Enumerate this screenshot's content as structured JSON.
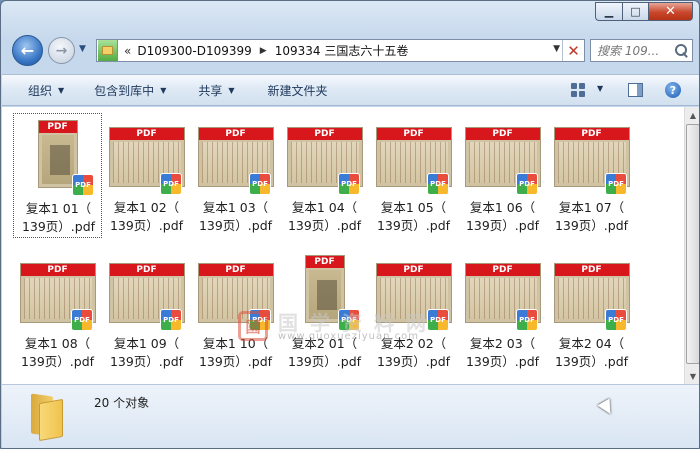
{
  "breadcrumb": {
    "overflow": "«",
    "items": [
      "D109300-D109399",
      "109334 三国志六十五卷"
    ]
  },
  "search": {
    "placeholder": "搜索 109..."
  },
  "toolbar": {
    "organize": "组织",
    "include_library": "包含到库中",
    "share": "共享",
    "new_folder": "新建文件夹"
  },
  "badge_label": "PDF",
  "files": [
    {
      "line1": "复本1 01（",
      "line2": "139页）.pdf",
      "selected": true
    },
    {
      "line1": "复本1 02（",
      "line2": "139页）.pdf"
    },
    {
      "line1": "复本1 03（",
      "line2": "139页）.pdf"
    },
    {
      "line1": "复本1 04（",
      "line2": "139页）.pdf"
    },
    {
      "line1": "复本1 05（",
      "line2": "139页）.pdf"
    },
    {
      "line1": "复本1 06（",
      "line2": "139页）.pdf"
    },
    {
      "line1": "复本1 07（",
      "line2": "139页）.pdf"
    },
    {
      "line1": "复本1 08（",
      "line2": "139页）.pdf"
    },
    {
      "line1": "复本1 09（",
      "line2": "139页）.pdf"
    },
    {
      "line1": "复本1 10（",
      "line2": "139页）.pdf"
    },
    {
      "line1": "复本2 01（",
      "line2": "139页）.pdf"
    },
    {
      "line1": "复本2 02（",
      "line2": "139页）.pdf"
    },
    {
      "line1": "复本2 03（",
      "line2": "139页）.pdf"
    },
    {
      "line1": "复本2 04（",
      "line2": "139页）.pdf"
    }
  ],
  "watermark": {
    "title": "国学资料网",
    "url": "www.guoxueziyuan.com"
  },
  "status": {
    "count_text": "20 个对象"
  },
  "colors": {
    "pdf_band": "#d8171d",
    "window_frame": "#c6d8ec",
    "selection_border": "#555555"
  },
  "icons": {
    "back": "back-arrow-icon",
    "forward": "forward-arrow-icon",
    "folder": "folder-icon",
    "search": "search-icon",
    "help": "help-icon",
    "pdf": "pdf-icon"
  }
}
